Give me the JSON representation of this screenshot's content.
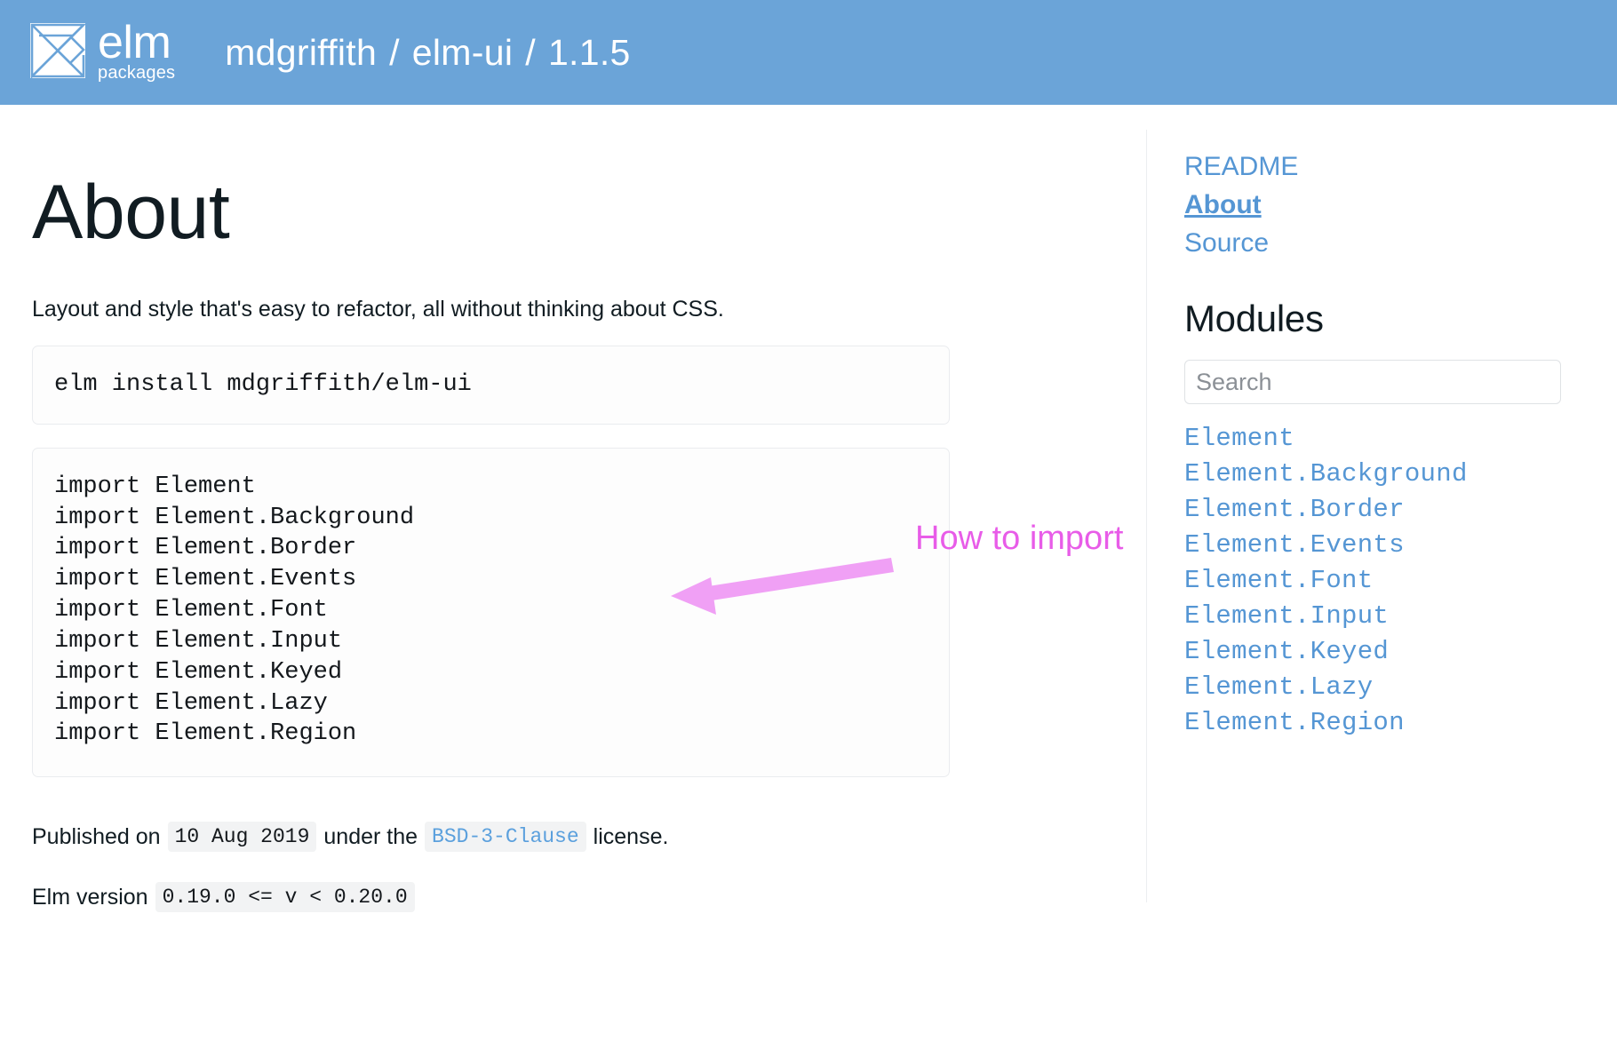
{
  "header": {
    "logo_word": "elm",
    "logo_sub": "packages",
    "logo_icon": "elm-logo-icon",
    "breadcrumb": {
      "author": "mdgriffith",
      "separator": "/",
      "package": "elm-ui",
      "version": "1.1.5"
    }
  },
  "main": {
    "title": "About",
    "tagline": "Layout and style that's easy to refactor, all without thinking about CSS.",
    "install_command": "elm install mdgriffith/elm-ui",
    "imports": "import Element\nimport Element.Background\nimport Element.Border\nimport Element.Events\nimport Element.Font\nimport Element.Input\nimport Element.Keyed\nimport Element.Lazy\nimport Element.Region",
    "published": {
      "prefix": "Published on",
      "date": "10 Aug 2019",
      "middle": "under the",
      "license": "BSD-3-Clause",
      "suffix": "license."
    },
    "elm_version": {
      "label": "Elm version",
      "range": "0.19.0 <= v < 0.20.0"
    }
  },
  "annotation": {
    "label": "How to import",
    "color": "#e85ce8",
    "arrow_color": "#f0a0f5"
  },
  "aside": {
    "nav": [
      {
        "label": "README",
        "current": false
      },
      {
        "label": "About",
        "current": true
      },
      {
        "label": "Source",
        "current": false
      }
    ],
    "modules_heading": "Modules",
    "search": {
      "value": "",
      "placeholder": "Search"
    },
    "modules": [
      "Element",
      "Element.Background",
      "Element.Border",
      "Element.Events",
      "Element.Font",
      "Element.Input",
      "Element.Keyed",
      "Element.Lazy",
      "Element.Region"
    ]
  },
  "colors": {
    "header_bg": "#6ba4d8",
    "link_blue": "#5596d4",
    "text_dark": "#111c22",
    "chip_bg": "#f2f3f4",
    "border": "#eaecef"
  }
}
